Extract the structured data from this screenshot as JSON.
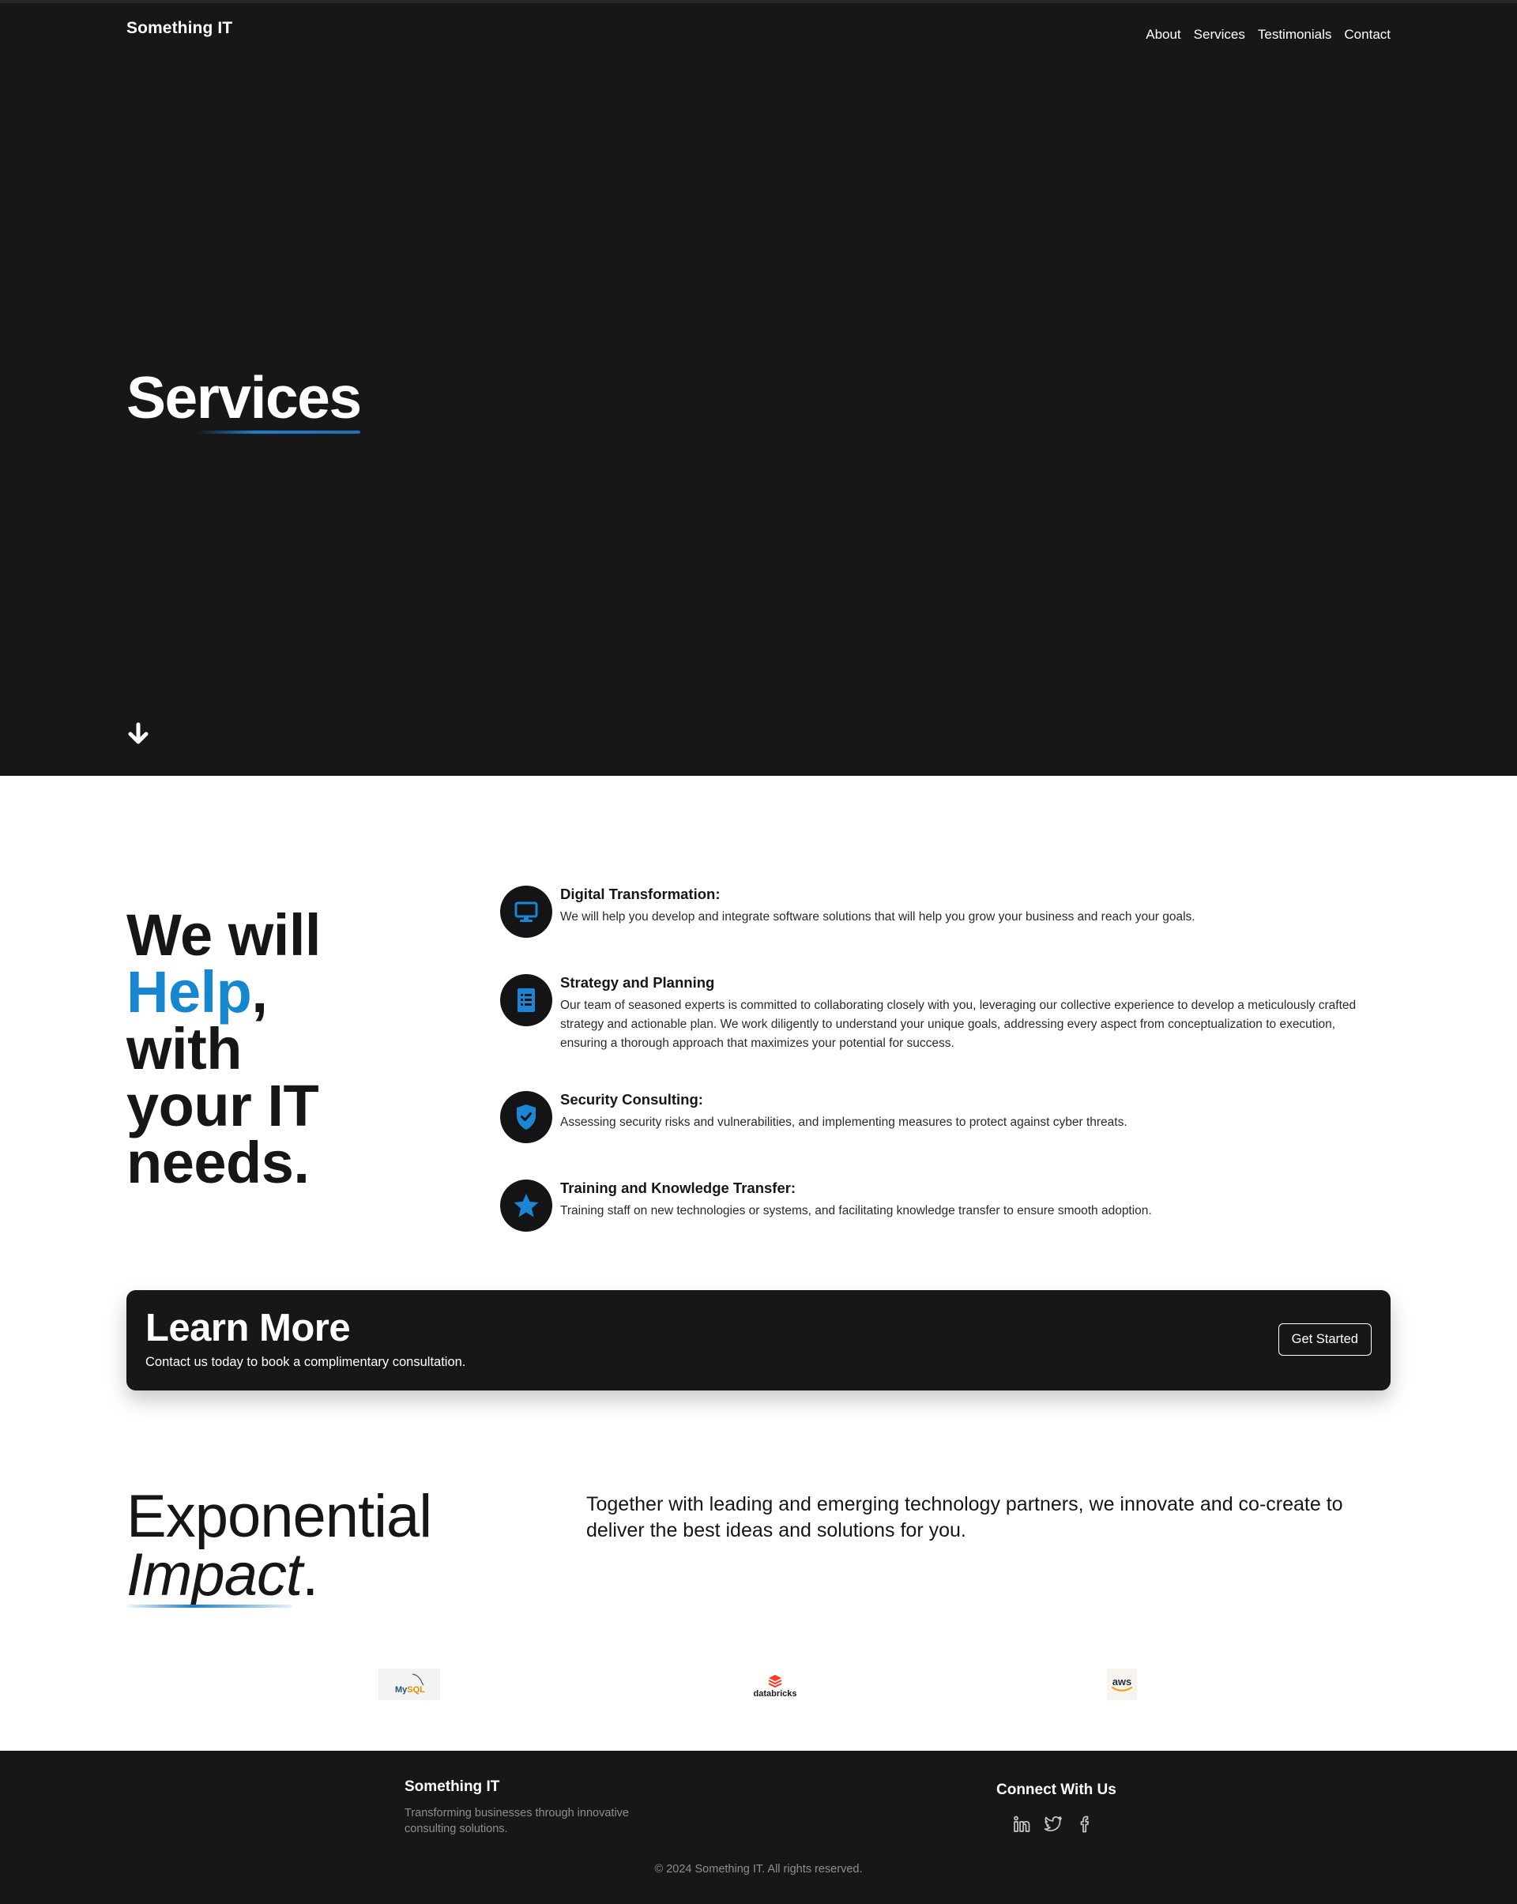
{
  "header": {
    "brand": "Something IT",
    "nav": [
      "About",
      "Services",
      "Testimonials",
      "Contact"
    ]
  },
  "hero": {
    "title": "Services",
    "scroll_icon": "arrow-down-icon"
  },
  "help": {
    "line1": "We will",
    "highlight": "Help",
    "comma": ",",
    "line3": "with",
    "line4": "your IT",
    "line5": "needs."
  },
  "services": [
    {
      "icon": "monitor-icon",
      "title": "Digital Transformation:",
      "description": "We will help you develop and integrate software solutions that will help you grow your business and reach your goals."
    },
    {
      "icon": "document-list-icon",
      "title": "Strategy and Planning",
      "description": "Our team of seasoned experts is committed to collaborating closely with you, leveraging our collective experience to develop a meticulously crafted strategy and actionable plan. We work diligently to understand your unique goals, addressing every aspect from conceptualization to execution, ensuring a thorough approach that maximizes your potential for success."
    },
    {
      "icon": "shield-check-icon",
      "title": "Security Consulting:",
      "description": "Assessing security risks and vulnerabilities, and implementing measures to protect against cyber threats."
    },
    {
      "icon": "star-icon",
      "title": "Training and Knowledge Transfer:",
      "description": "Training staff on new technologies or systems, and facilitating knowledge transfer to ensure smooth adoption."
    }
  ],
  "banner": {
    "title": "Learn More",
    "subtitle": "Contact us today to book a complimentary consultation.",
    "button": "Get Started"
  },
  "impact": {
    "word1": "Exponential",
    "word2": "Impact",
    "period": ".",
    "paragraph": "Together with leading and emerging technology partners, we innovate and co-create to deliver the best ideas and solutions for you."
  },
  "partners": {
    "mysql_my": "My",
    "mysql_sql": "SQL",
    "databricks": "databricks",
    "aws": "aws"
  },
  "footer": {
    "brand": "Something IT",
    "tagline": "Transforming businesses through innovative consulting solutions.",
    "connect_heading": "Connect With Us",
    "social": [
      "linkedin-icon",
      "twitter-icon",
      "facebook-icon"
    ],
    "copyright": "© 2024 Something IT. All rights reserved."
  },
  "colors": {
    "accent": "#1786d1",
    "dark": "#171718",
    "text": "#161617",
    "muted": "#8e8e93"
  }
}
